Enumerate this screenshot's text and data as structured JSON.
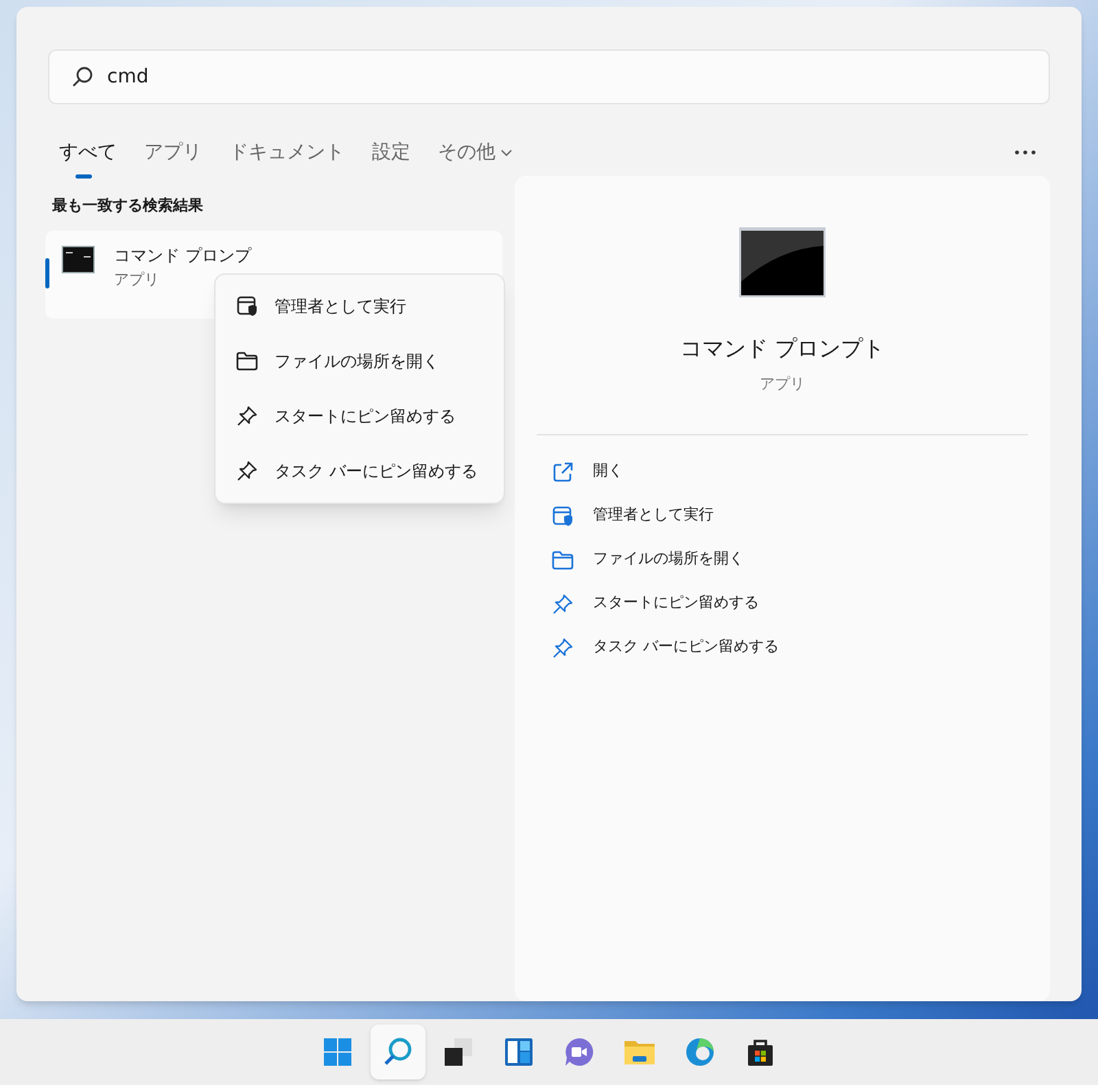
{
  "search": {
    "value": "cmd"
  },
  "tabs": [
    {
      "label": "すべて",
      "selected": true,
      "kind": "tab"
    },
    {
      "label": "アプリ",
      "selected": false,
      "kind": "tab"
    },
    {
      "label": "ドキュメント",
      "selected": false,
      "kind": "tab"
    },
    {
      "label": "設定",
      "selected": false,
      "kind": "tab"
    },
    {
      "label": "その他",
      "selected": false,
      "kind": "dropdown"
    }
  ],
  "best_match": {
    "heading": "最も一致する検索結果",
    "result": {
      "title": "コマンド プロンプ",
      "subtitle": "アプリ",
      "selected": true
    }
  },
  "context_menu": [
    {
      "label": "管理者として実行",
      "kind": "shield"
    },
    {
      "label": "ファイルの場所を開く",
      "kind": "folder"
    },
    {
      "label": "スタートにピン留めする",
      "kind": "pin"
    },
    {
      "label": "タスク バーにピン留めする",
      "kind": "pin"
    }
  ],
  "details": {
    "title": "コマンド プロンプト",
    "subtitle": "アプリ",
    "actions": [
      {
        "label": "開く",
        "kind": "open"
      },
      {
        "label": "管理者として実行",
        "kind": "shield"
      },
      {
        "label": "ファイルの場所を開く",
        "kind": "folder"
      },
      {
        "label": "スタートにピン留めする",
        "kind": "pin"
      },
      {
        "label": "タスク バーにピン留めする",
        "kind": "pin"
      }
    ]
  },
  "taskbar": [
    {
      "kind": "start",
      "selected": false
    },
    {
      "kind": "search",
      "selected": true
    },
    {
      "kind": "taskview",
      "selected": false
    },
    {
      "kind": "widgets",
      "selected": false
    },
    {
      "kind": "chat",
      "selected": false
    },
    {
      "kind": "explorer",
      "selected": false
    },
    {
      "kind": "edge",
      "selected": false
    },
    {
      "kind": "store",
      "selected": false
    }
  ]
}
